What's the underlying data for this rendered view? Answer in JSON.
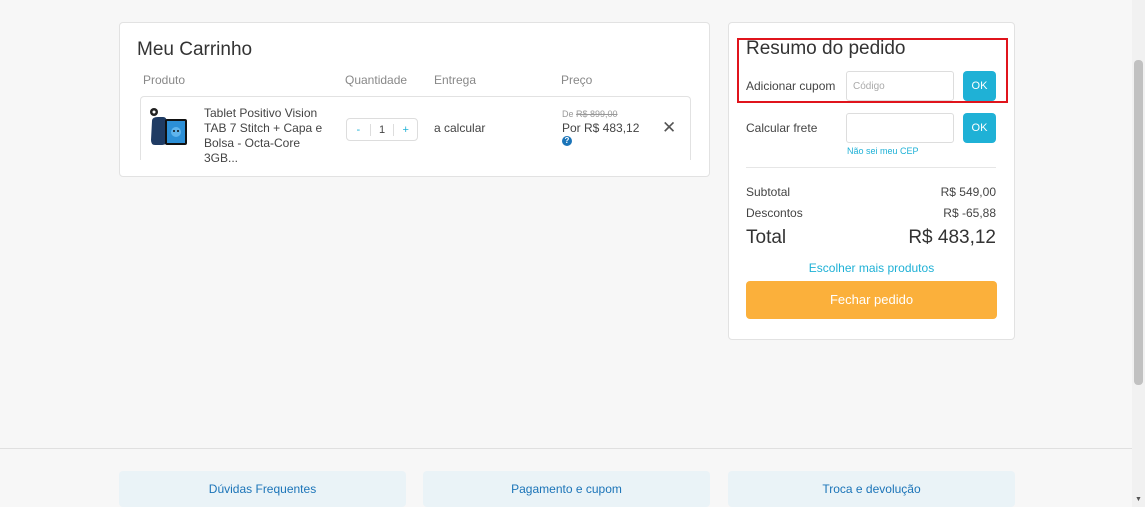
{
  "cart": {
    "title": "Meu Carrinho",
    "columns": {
      "product": "Produto",
      "quantity": "Quantidade",
      "delivery": "Entrega",
      "price": "Preço"
    },
    "item": {
      "name": "Tablet Positivo Vision TAB 7 Stitch + Capa e Bolsa - Octa-Core 3GB...",
      "qty_minus": "-",
      "qty_value": "1",
      "qty_plus": "+",
      "delivery": "a calcular",
      "price_old_prefix": "De ",
      "price_old": "R$ 899,00",
      "price_new": "Por R$ 483,12",
      "help": "?",
      "remove": "✕"
    }
  },
  "summary": {
    "title": "Resumo do pedido",
    "coupon_label": "Adicionar cupom",
    "coupon_placeholder": "Código",
    "coupon_ok": "OK",
    "freight_label": "Calcular frete",
    "freight_ok": "OK",
    "cep_link": "Não sei meu CEP",
    "subtotal_label": "Subtotal",
    "subtotal_value": "R$ 549,00",
    "discount_label": "Descontos",
    "discount_value": "R$ -65,88",
    "total_label": "Total",
    "total_value": "R$ 483,12",
    "more_products": "Escolher mais produtos",
    "checkout": "Fechar pedido"
  },
  "footer": {
    "faq": "Dúvidas Frequentes",
    "payment": "Pagamento e cupom",
    "returns": "Troca e devolução"
  },
  "colors": {
    "accent": "#1fb1d6",
    "checkout": "#fbb03b",
    "highlight": "#e0141c"
  }
}
